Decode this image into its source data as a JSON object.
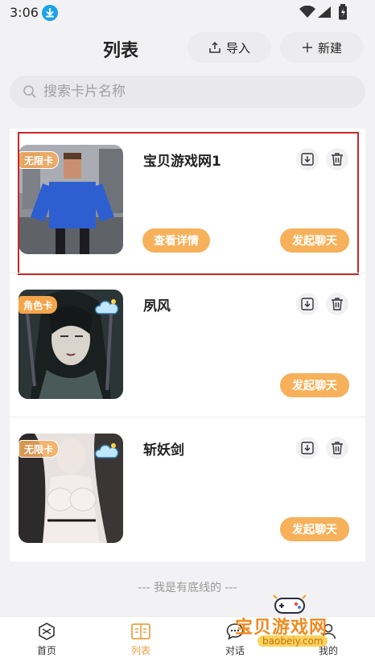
{
  "status_bar": {
    "time": "3:06"
  },
  "header": {
    "title": "列表",
    "import_label": "导入",
    "new_label": "新建"
  },
  "search": {
    "placeholder": "搜索卡片名称",
    "value": ""
  },
  "cards": [
    {
      "title": "宝贝游戏网1",
      "badge": "无限卡",
      "detail_label": "查看详情",
      "chat_label": "发起聊天"
    },
    {
      "title": "夙风",
      "badge": "角色卡",
      "chat_label": "发起聊天"
    },
    {
      "title": "斩妖剑",
      "badge": "无限卡",
      "chat_label": "发起聊天"
    }
  ],
  "footer_note": "--- 我是有底线的 ---",
  "tabs": [
    {
      "label": "首页",
      "icon": "home-icon"
    },
    {
      "label": "列表",
      "icon": "list-icon",
      "active": true
    },
    {
      "label": "对话",
      "icon": "chat-bubble-icon"
    },
    {
      "label": "我的",
      "icon": "profile-icon"
    }
  ],
  "watermark": {
    "text": "宝贝游戏网",
    "url": "baobeiy.com"
  },
  "colors": {
    "accent": "#F6B15A",
    "active_tab": "#F0A040",
    "selection_border": "#C62828",
    "download_badge": "#1AA3E8"
  }
}
